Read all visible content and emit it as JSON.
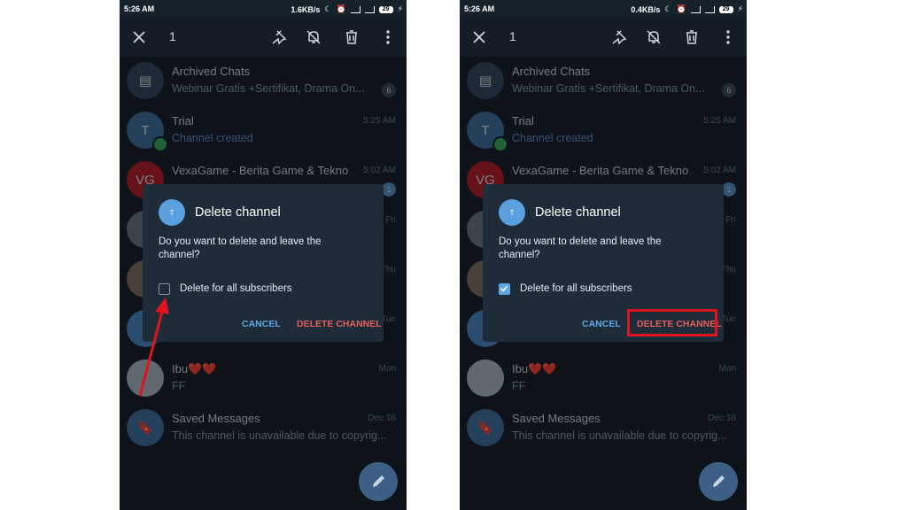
{
  "status": {
    "time": "5:26 AM",
    "speed_left": "1.6KB/s",
    "speed_right": "0.4KB/s",
    "battery": "29"
  },
  "toolbar": {
    "count": "1",
    "icons": [
      "close-icon",
      "pin-icon",
      "mute-icon",
      "delete-icon",
      "more-icon"
    ]
  },
  "chats": [
    {
      "name": "Archived Chats",
      "preview": "Webinar Gratis +Sertifikat, Drama On...",
      "time": "",
      "badge": "6"
    },
    {
      "name": "Trial",
      "preview": "Channel created",
      "time": "5:25 AM",
      "avatar": "T"
    },
    {
      "name": "VexaGame - Berita Game & Tekno",
      "preview": "",
      "time": "5:02 AM",
      "badge": "1",
      "avatar": "VG"
    },
    {
      "name": "",
      "preview": "",
      "time": "Fri"
    },
    {
      "name": "",
      "preview": "",
      "time": "Thu"
    },
    {
      "name": "",
      "preview": "",
      "time": "Tue"
    },
    {
      "name": "Ibu❤️❤️",
      "preview": "FF",
      "time": "Mon"
    },
    {
      "name": "Saved Messages",
      "preview": "This channel is unavailable due to copyrig...",
      "time": "Dec 16"
    }
  ],
  "dialog": {
    "avatar": "T",
    "title": "Delete channel",
    "message": "Do you want to delete and leave the channel?",
    "checkbox_label": "Delete for all subscribers",
    "checkbox_left_checked": false,
    "checkbox_right_checked": true,
    "cancel": "CANCEL",
    "delete": "DELETE CHANNEL"
  },
  "colors": {
    "annotation": "#e0141c",
    "accent": "#5fa6e2",
    "danger": "#e65e5e"
  }
}
